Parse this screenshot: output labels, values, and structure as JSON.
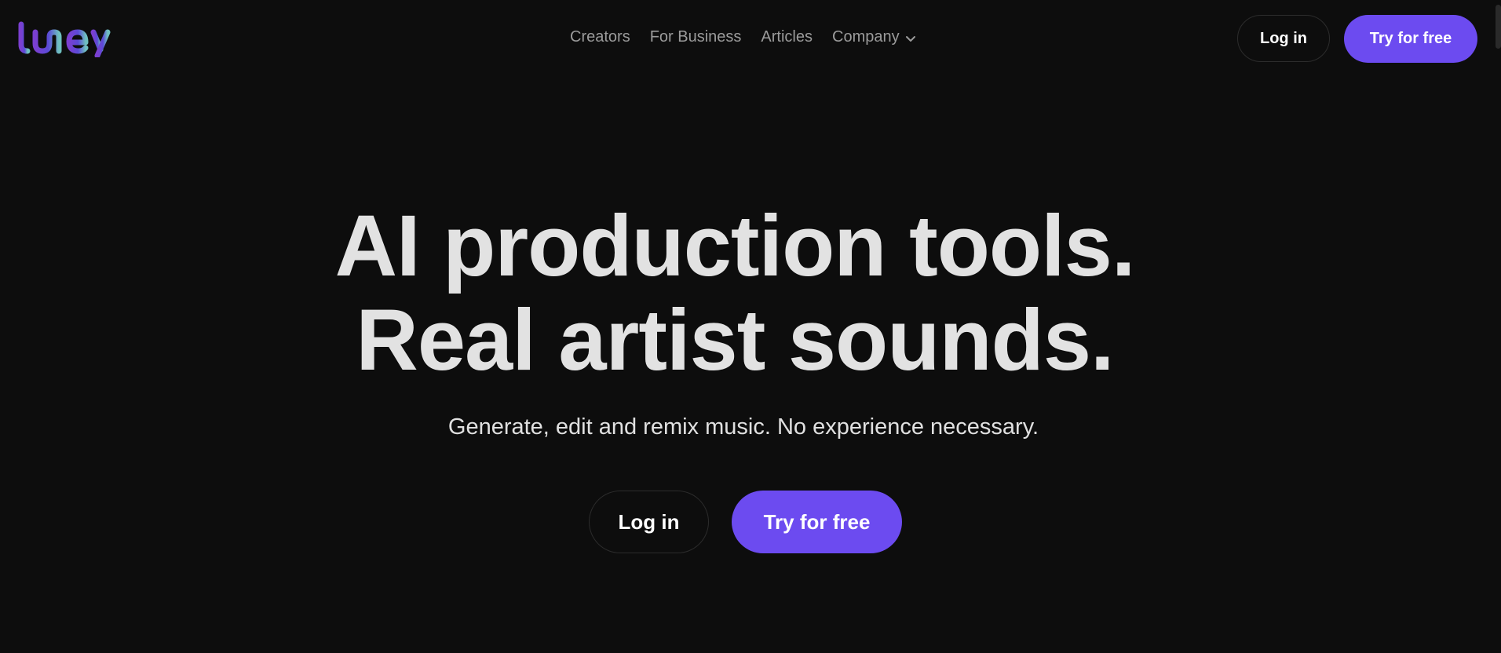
{
  "header": {
    "logo_text": "tuney",
    "nav": [
      {
        "label": "Creators"
      },
      {
        "label": "For Business"
      },
      {
        "label": "Articles"
      },
      {
        "label": "Company"
      }
    ],
    "login_label": "Log in",
    "try_label": "Try for free"
  },
  "hero": {
    "title_line1": "AI production tools.",
    "title_line2": "Real artist sounds.",
    "subtitle": "Generate, edit and remix music. No experience necessary.",
    "login_label": "Log in",
    "try_label": "Try for free"
  },
  "colors": {
    "background": "#0d0d0d",
    "accent": "#6c4bf0",
    "nav_text": "#9b9b9b",
    "heading": "#e2e2e2",
    "logo_gradient": [
      "#7b3fd0",
      "#5a4ad6",
      "#6fb8c4"
    ]
  },
  "icons": {
    "company_dropdown": "chevron-down-icon"
  }
}
